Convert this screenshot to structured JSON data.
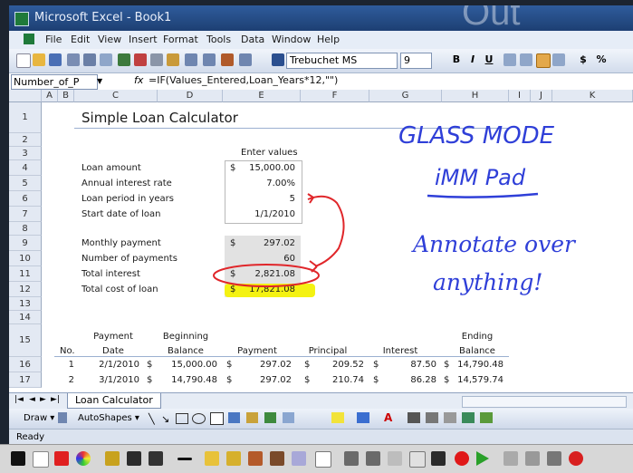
{
  "window": {
    "title": "Microsoft Excel - Book1",
    "brand": "Out"
  },
  "menu": [
    "File",
    "Edit",
    "View",
    "Insert",
    "Format",
    "Tools",
    "Data",
    "Window",
    "Help"
  ],
  "toolbar": {
    "font_name": "Trebuchet MS",
    "font_size": "9",
    "bold": "B",
    "italic": "I",
    "underline": "U",
    "currency": "$",
    "percent": "%"
  },
  "formula_bar": {
    "name_box": "Number_of_P",
    "fx": "fx",
    "formula": "=IF(Values_Entered,Loan_Years*12,\"\")"
  },
  "columns": [
    "A",
    "B",
    "C",
    "D",
    "E",
    "F",
    "G",
    "H",
    "I",
    "J",
    "K"
  ],
  "rows": [
    "1",
    "2",
    "3",
    "4",
    "5",
    "6",
    "7",
    "8",
    "9",
    "10",
    "11",
    "12",
    "13",
    "14",
    "15",
    "16",
    "17"
  ],
  "sheet": {
    "title": "Simple Loan Calculator",
    "enter_values": "Enter values",
    "inputs": [
      {
        "label": "Loan amount",
        "cur": "$",
        "value": "15,000.00"
      },
      {
        "label": "Annual interest rate",
        "cur": "",
        "value": "7.00%"
      },
      {
        "label": "Loan period in years",
        "cur": "",
        "value": "5"
      },
      {
        "label": "Start date of loan",
        "cur": "",
        "value": "1/1/2010"
      }
    ],
    "outputs": [
      {
        "label": "Monthly payment",
        "cur": "$",
        "value": "297.02"
      },
      {
        "label": "Number of payments",
        "cur": "",
        "value": "60"
      },
      {
        "label": "Total interest",
        "cur": "$",
        "value": "2,821.08"
      },
      {
        "label": "Total cost of loan",
        "cur": "$",
        "value": "17,821.08"
      }
    ],
    "table_header_top": {
      "payment": "Payment",
      "beginning": "Beginning",
      "ending": "Ending"
    },
    "table_header": {
      "no": "No.",
      "date": "Date",
      "balance": "Balance",
      "payment": "Payment",
      "principal": "Principal",
      "interest": "Interest",
      "ending_balance": "Balance"
    },
    "table_rows": [
      {
        "no": "1",
        "date": "2/1/2010",
        "beg": "15,000.00",
        "pay": "297.02",
        "prin": "209.52",
        "int": "87.50",
        "end": "14,790.48"
      },
      {
        "no": "2",
        "date": "3/1/2010",
        "beg": "14,790.48",
        "pay": "297.02",
        "prin": "210.74",
        "int": "86.28",
        "end": "14,579.74"
      }
    ]
  },
  "sheet_tab": "Loan Calculator",
  "drawing_toolbar": {
    "draw": "Draw ▾",
    "autoshapes": "AutoShapes ▾"
  },
  "status": "Ready",
  "annotations": {
    "line1": "GLASS MODE",
    "line2": "iMM Pad",
    "line3": "Annotate over",
    "line4": "anything!"
  },
  "colors": {
    "ink_blue": "#2f3fd8",
    "ink_red": "#e0262a",
    "highlight": "#f4f212"
  }
}
